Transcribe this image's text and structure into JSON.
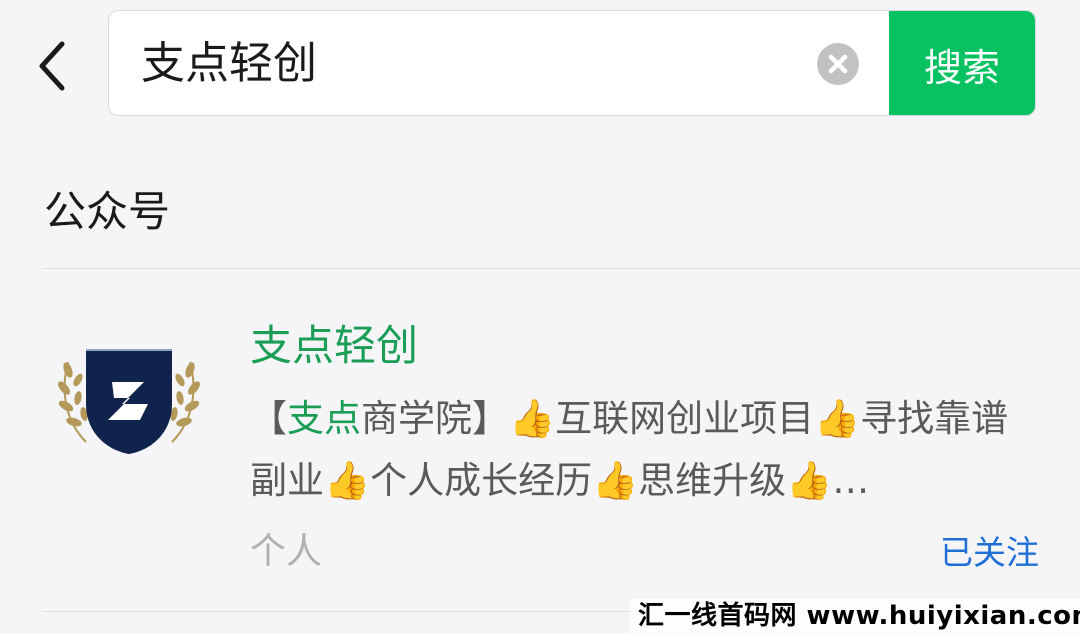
{
  "search": {
    "query": "支点轻创",
    "button_label": "搜索"
  },
  "section": {
    "title": "公众号"
  },
  "result": {
    "name": "支点轻创",
    "description": {
      "bracket_open": "【",
      "highlight": "支点",
      "rest": "商学院】👍互联网创业项目👍寻找靠谱副业👍个人成长经历👍思维升级👍…"
    },
    "account_type": "个人",
    "follow_status": "已关注"
  },
  "watermark": "汇一线首码网 www.huiyixian.com",
  "colors": {
    "accent_green": "#08c160",
    "highlight_green": "#1a9e56",
    "link_blue": "#1f6fd6",
    "badge_navy": "#10234d"
  },
  "icons": {
    "back": "chevron-left-icon",
    "clear": "clear-circle-icon",
    "avatar": "laurel-shield-logo"
  }
}
